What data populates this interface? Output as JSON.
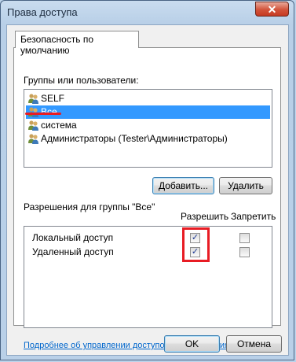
{
  "window": {
    "title": "Права доступа",
    "close_glyph": "✕"
  },
  "tab": {
    "label": "Безопасность по умолчанию"
  },
  "groups": {
    "label": "Группы или пользователи:",
    "items": [
      {
        "label": "SELF",
        "icon": "users-icon"
      },
      {
        "label": "Все",
        "icon": "users-icon",
        "selected": true
      },
      {
        "label": "система",
        "icon": "users-icon"
      },
      {
        "label": "Администраторы (Tester\\Администраторы)",
        "icon": "users-icon"
      }
    ]
  },
  "buttons": {
    "add": "Добавить...",
    "remove": "Удалить",
    "ok": "OK",
    "cancel": "Отмена"
  },
  "permissions": {
    "label": "Разрешения для группы \"Все\"",
    "allow_header": "Разрешить",
    "deny_header": "Запретить",
    "rows": [
      {
        "label": "Локальный доступ",
        "allow": true,
        "deny": false
      },
      {
        "label": "Удаленный доступ",
        "allow": true,
        "deny": false
      }
    ]
  },
  "help_link": "Подробнее об управлении доступом и разрешениях",
  "colors": {
    "selection": "#3399ff",
    "annotation_red": "#e81c24",
    "link": "#0066cc"
  }
}
